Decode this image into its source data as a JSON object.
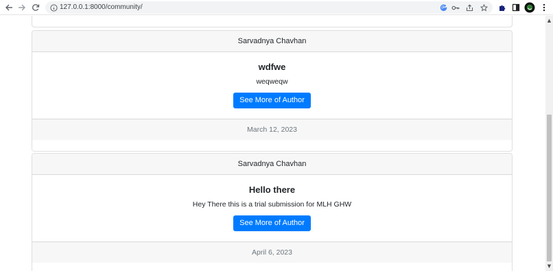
{
  "browser": {
    "url": "127.0.0.1:8000/community/",
    "icons": {
      "back": "arrow-left-icon",
      "forward": "arrow-right-icon",
      "reload": "reload-icon",
      "site_info": "info-icon",
      "google": "google-icon",
      "password": "key-icon",
      "share": "share-icon",
      "bookmark": "star-icon",
      "extensions": "puzzle-icon",
      "side_panel": "side-panel-icon",
      "profile": "profile-avatar",
      "menu": "kebab-menu-icon"
    }
  },
  "posts": [
    {
      "author": "Sarvadnya Chavhan",
      "title": "wdfwe",
      "content": "weqweqw",
      "button_label": "See More of Author",
      "date": "March 12, 2023"
    },
    {
      "author": "Sarvadnya Chavhan",
      "title": "Hello there",
      "content": "Hey There this is a trial submission for MLH GHW",
      "button_label": "See More of Author",
      "date": "April 6, 2023"
    }
  ],
  "colors": {
    "primary": "#007bff",
    "card_cap": "#f7f7f7",
    "muted_text": "#6c757d",
    "body_text": "#212529"
  }
}
